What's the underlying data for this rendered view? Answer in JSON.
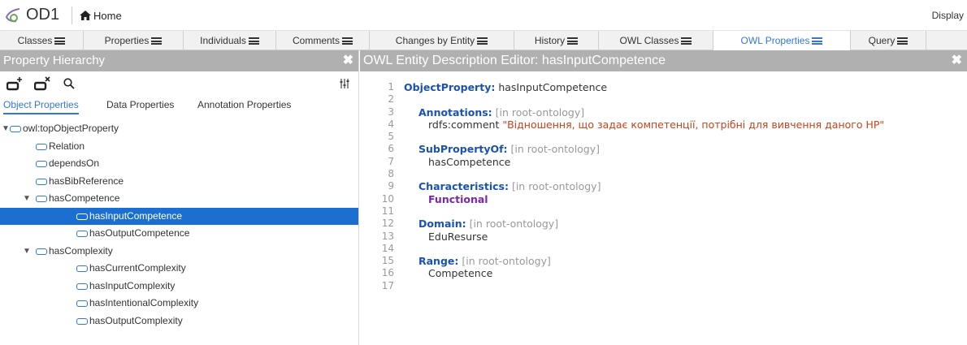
{
  "topbar": {
    "app_name": "OD1",
    "home_label": "Home",
    "display_label": "Display"
  },
  "tabs": [
    {
      "label": "Classes",
      "active": false
    },
    {
      "label": "Properties",
      "active": false
    },
    {
      "label": "Individuals",
      "active": false
    },
    {
      "label": "Comments",
      "active": false
    },
    {
      "label": "Changes by Entity",
      "active": false
    },
    {
      "label": "History",
      "active": false
    },
    {
      "label": "OWL Classes",
      "active": false
    },
    {
      "label": "OWL Properties",
      "active": true
    },
    {
      "label": "Query",
      "active": false
    }
  ],
  "left_panel": {
    "title": "Property Hierarchy",
    "close": "✖",
    "subtabs": [
      "Object Properties",
      "Data Properties",
      "Annotation Properties"
    ],
    "tree": [
      {
        "label": "owl:topObjectProperty",
        "level": 0,
        "expanded": true,
        "selected": false
      },
      {
        "label": "Relation",
        "level": 1,
        "expanded": false,
        "selected": false
      },
      {
        "label": "dependsOn",
        "level": 1,
        "expanded": false,
        "selected": false
      },
      {
        "label": "hasBibReference",
        "level": 1,
        "expanded": false,
        "selected": false
      },
      {
        "label": "hasCompetence",
        "level": 1,
        "expanded": true,
        "selected": false
      },
      {
        "label": "hasInputCompetence",
        "level": 2,
        "expanded": false,
        "selected": true
      },
      {
        "label": "hasOutputCompetence",
        "level": 2,
        "expanded": false,
        "selected": false
      },
      {
        "label": "hasComplexity",
        "level": 1,
        "expanded": true,
        "selected": false
      },
      {
        "label": "hasCurrentComplexity",
        "level": 2,
        "expanded": false,
        "selected": false
      },
      {
        "label": "hasInputComplexity",
        "level": 2,
        "expanded": false,
        "selected": false
      },
      {
        "label": "hasIntentionalComplexity",
        "level": 2,
        "expanded": false,
        "selected": false
      },
      {
        "label": "hasOutputComplexity",
        "level": 2,
        "expanded": false,
        "selected": false
      }
    ]
  },
  "right_panel": {
    "title": "OWL Entity Description Editor: hasInputCompetence",
    "close": "✖",
    "lines": [
      {
        "n": "1",
        "parts": [
          {
            "t": "ObjectProperty:",
            "c": "kw"
          },
          {
            "t": " hasInputCompetence",
            "c": "tx"
          }
        ]
      },
      {
        "n": "2",
        "parts": []
      },
      {
        "n": "3",
        "indent": 1,
        "parts": [
          {
            "t": "Annotations:",
            "c": "kw"
          },
          {
            "t": " [in root-ontology]",
            "c": "cm"
          }
        ]
      },
      {
        "n": "4",
        "indent": 2,
        "parts": [
          {
            "t": "rdfs:comment ",
            "c": "tx"
          },
          {
            "t": "\"Відношення, що задає компетенції, потрібні для вивчення даного НР\"",
            "c": "str"
          }
        ]
      },
      {
        "n": "5",
        "parts": []
      },
      {
        "n": "6",
        "indent": 1,
        "parts": [
          {
            "t": "SubPropertyOf:",
            "c": "kw"
          },
          {
            "t": " [in root-ontology]",
            "c": "cm"
          }
        ]
      },
      {
        "n": "7",
        "indent": 2,
        "parts": [
          {
            "t": "hasCompetence",
            "c": "tx"
          }
        ]
      },
      {
        "n": "8",
        "parts": []
      },
      {
        "n": "9",
        "indent": 1,
        "parts": [
          {
            "t": "Characteristics:",
            "c": "kw"
          },
          {
            "t": " [in root-ontology]",
            "c": "cm"
          }
        ]
      },
      {
        "n": "10",
        "indent": 2,
        "parts": [
          {
            "t": "Functional",
            "c": "fn"
          }
        ]
      },
      {
        "n": "11",
        "parts": []
      },
      {
        "n": "12",
        "indent": 1,
        "parts": [
          {
            "t": "Domain:",
            "c": "kw"
          },
          {
            "t": " [in root-ontology]",
            "c": "cm"
          }
        ]
      },
      {
        "n": "13",
        "indent": 2,
        "parts": [
          {
            "t": "EduResurse",
            "c": "tx"
          }
        ]
      },
      {
        "n": "14",
        "parts": []
      },
      {
        "n": "15",
        "indent": 1,
        "parts": [
          {
            "t": "Range:",
            "c": "kw"
          },
          {
            "t": " [in root-ontology]",
            "c": "cm"
          }
        ]
      },
      {
        "n": "16",
        "indent": 2,
        "parts": [
          {
            "t": "Competence",
            "c": "tx"
          }
        ]
      },
      {
        "n": "17",
        "parts": []
      }
    ]
  }
}
